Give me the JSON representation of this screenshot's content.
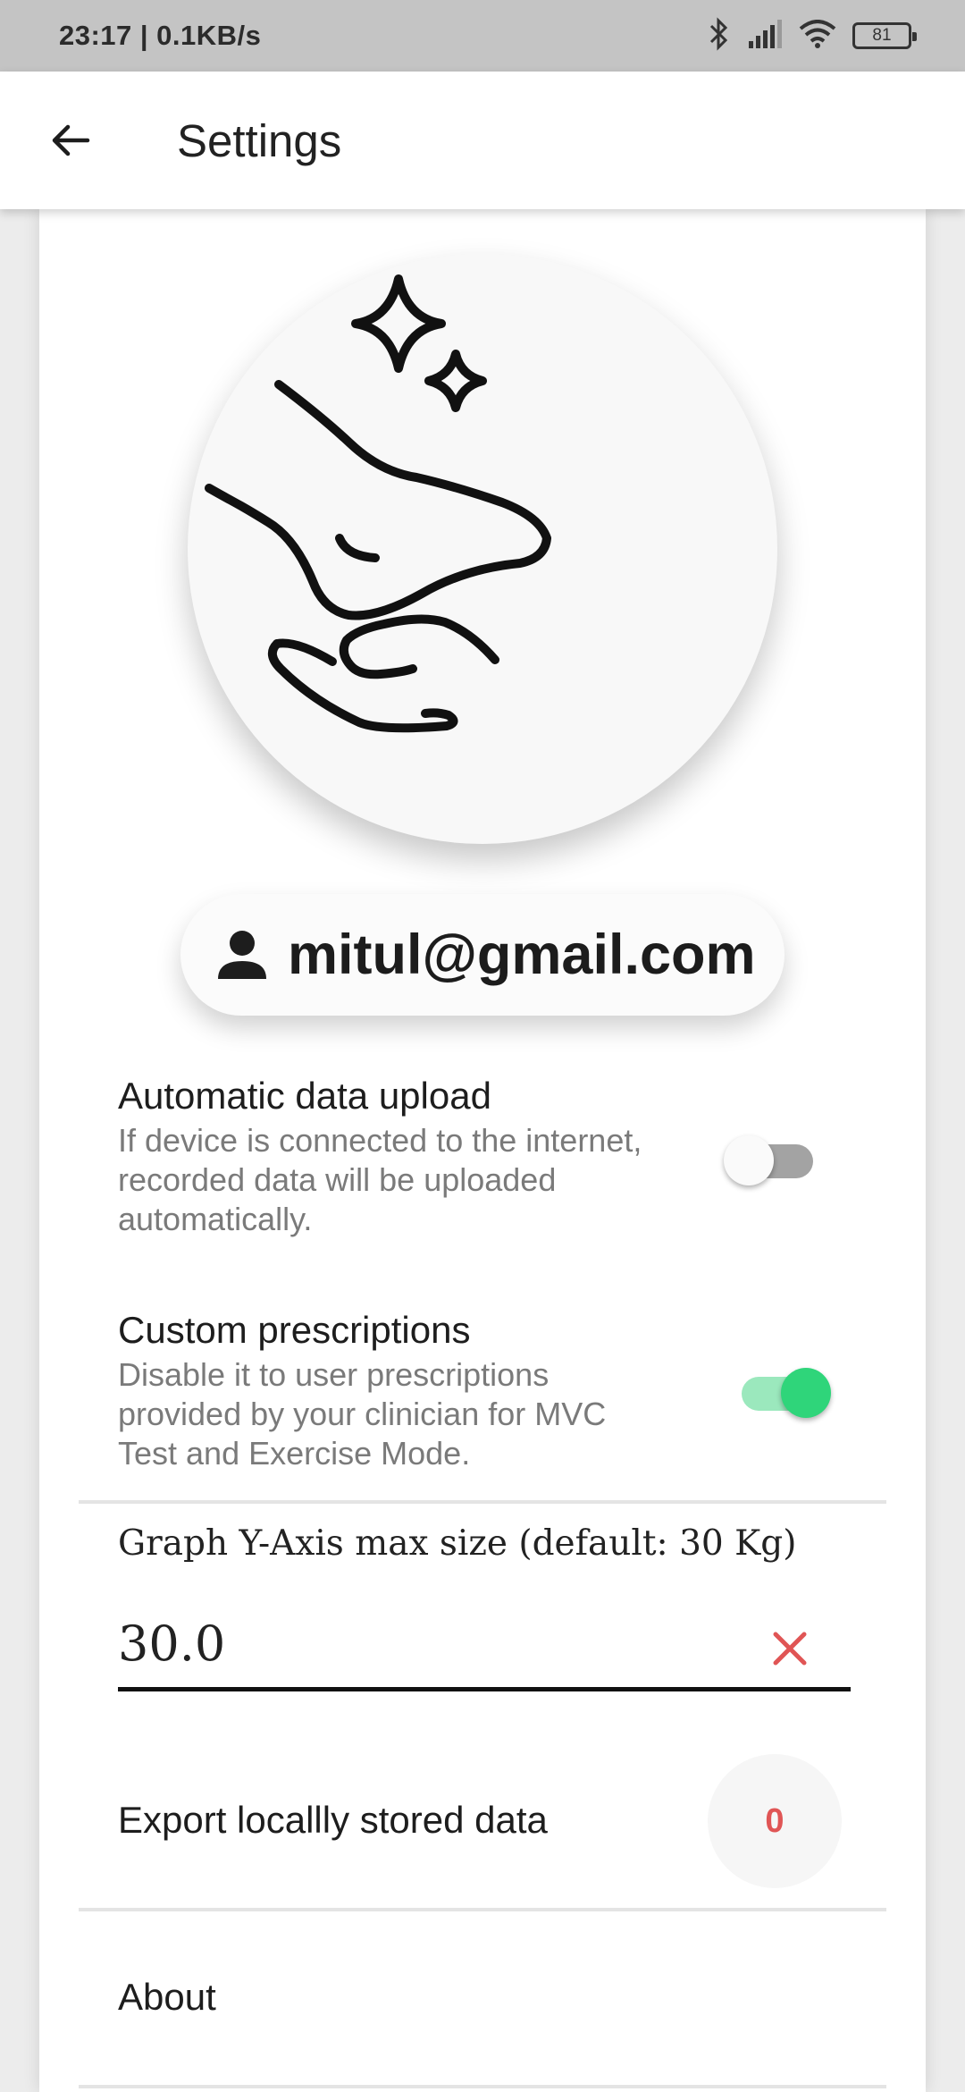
{
  "status_bar": {
    "time": "23:17 | 0.1KB/s",
    "battery": "81"
  },
  "app_bar": {
    "title": "Settings"
  },
  "profile": {
    "email": "mitul@gmail.com"
  },
  "settings": [
    {
      "title": "Automatic data upload",
      "description": "If device is connected to the internet, recorded data will be uploaded automatically.",
      "enabled": false
    },
    {
      "title": "Custom prescriptions",
      "description": "Disable it to user prescriptions provided by your clinician for MVC Test and Exercise Mode.",
      "enabled": true
    }
  ],
  "graph_field": {
    "label": "Graph Y-Axis max size (default: 30 Kg)",
    "value": "30.0"
  },
  "export": {
    "label": "Export locallly stored data",
    "count": "0"
  },
  "about": {
    "label": "About"
  },
  "colors": {
    "accent_on": "#2fd57a",
    "clear_red": "#e05555"
  }
}
